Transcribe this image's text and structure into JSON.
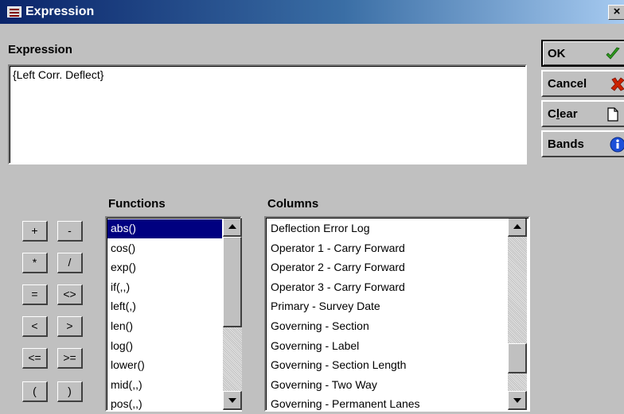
{
  "window": {
    "title": "Expression",
    "close_label": "×"
  },
  "expression": {
    "label": "Expression",
    "value": "{Left Corr. Deflect}"
  },
  "buttons": {
    "ok": "OK",
    "cancel": "Cancel",
    "clear_pre": "C",
    "clear_accel": "l",
    "clear_post": "ear",
    "bands": "Bands"
  },
  "icons": {
    "ok": "checkmark-icon",
    "cancel": "red-x-icon",
    "clear": "blank-document-icon",
    "bands": "info-icon"
  },
  "colors": {
    "check": "#2e9a1e",
    "cancel": "#cc2200",
    "info": "#1c4fd8",
    "selection": "#000080"
  },
  "operators": [
    "+",
    "-",
    "*",
    "/",
    "=",
    "<>",
    "<",
    ">",
    "<=",
    ">=",
    "(",
    ")"
  ],
  "functions": {
    "label": "Functions",
    "items": [
      "abs()",
      "cos()",
      "exp()",
      "if(,,)",
      "left(,)",
      "len()",
      "log()",
      "lower()",
      "mid(,,)",
      "pos(,,)"
    ],
    "selected": "abs()"
  },
  "columns": {
    "label": "Columns",
    "items": [
      "Deflection Error Log",
      "Operator 1 - Carry Forward",
      "Operator 2 - Carry Forward",
      "Operator 3 - Carry Forward",
      "Primary - Survey Date",
      "Governing - Section",
      "Governing - Label",
      "Governing - Section Length",
      "Governing - Two Way",
      "Governing - Permanent Lanes"
    ]
  }
}
